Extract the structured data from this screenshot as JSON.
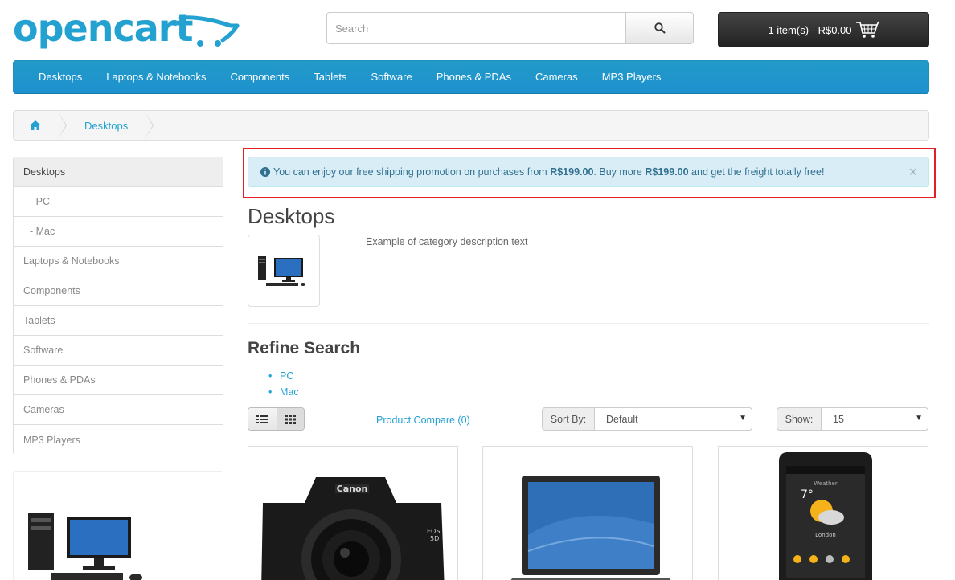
{
  "brand": {
    "logo_text": "opencart",
    "accent": "#23a1d1"
  },
  "search": {
    "placeholder": "Search",
    "value": ""
  },
  "cart": {
    "label": "1 item(s) - R$0.00"
  },
  "menu": {
    "items": [
      "Desktops",
      "Laptops & Notebooks",
      "Components",
      "Tablets",
      "Software",
      "Phones & PDAs",
      "Cameras",
      "MP3 Players"
    ]
  },
  "breadcrumb": {
    "current": "Desktops"
  },
  "sidebar": {
    "items": [
      {
        "label": "Desktops",
        "active": true
      },
      {
        "label": "- PC"
      },
      {
        "label": "- Mac"
      },
      {
        "label": "Laptops & Notebooks"
      },
      {
        "label": "Components"
      },
      {
        "label": "Tablets"
      },
      {
        "label": "Software"
      },
      {
        "label": "Phones & PDAs"
      },
      {
        "label": "Cameras"
      },
      {
        "label": "MP3 Players"
      }
    ]
  },
  "alert": {
    "text_1": "You can enjoy our free shipping promotion on purchases from ",
    "amount_1": "R$199.00",
    "text_2": ". Buy more ",
    "amount_2": "R$199.00",
    "text_3": " and get the freight totally free!",
    "close": "×"
  },
  "category": {
    "title": "Desktops",
    "description": "Example of category description text"
  },
  "refine": {
    "title": "Refine Search",
    "links": [
      "PC",
      "Mac"
    ]
  },
  "toolbar": {
    "compare": "Product Compare (0)",
    "sort_label": "Sort By:",
    "sort_value": "Default",
    "show_label": "Show:",
    "show_value": "15"
  },
  "products": [
    {
      "image": "canon-eos-5d-camera"
    },
    {
      "image": "hp-laptop"
    },
    {
      "image": "htc-touch-hd-phone"
    }
  ]
}
